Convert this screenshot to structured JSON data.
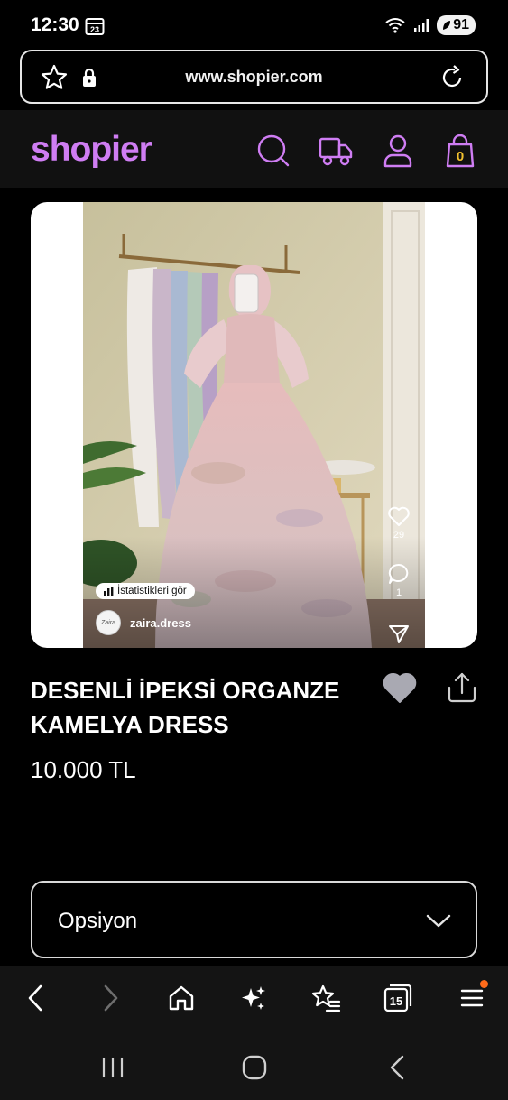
{
  "status_bar": {
    "time": "12:30",
    "calendar_day": "23",
    "battery": "91"
  },
  "browser": {
    "url": "www.shopier.com",
    "tab_count": "15"
  },
  "header": {
    "logo": "shopier",
    "cart_count": "0"
  },
  "product": {
    "title": "DESENLİ İPEKSİ ORGANZE KAMELYA DRESS",
    "price": "10.000 TL",
    "image": {
      "stats_label": "İstatistikleri gör",
      "username": "zaira.dress",
      "avatar_text": "Zaira",
      "likes": "29",
      "comments": "1"
    }
  },
  "option_select": {
    "label": "Opsiyon"
  },
  "colors": {
    "brand": "#cf7df3",
    "cart_badge": "#f2c12e",
    "background": "#000000",
    "header_bg": "#111111"
  },
  "icons": {
    "header": [
      "search-icon",
      "truck-icon",
      "user-icon",
      "bag-icon"
    ],
    "toolbar": [
      "back-icon",
      "forward-icon",
      "home-icon",
      "sparkle-icon",
      "bookmarks-icon",
      "tabs-icon",
      "menu-icon"
    ],
    "system": [
      "recents-icon",
      "home-circle-icon",
      "back-chevron-icon"
    ]
  }
}
